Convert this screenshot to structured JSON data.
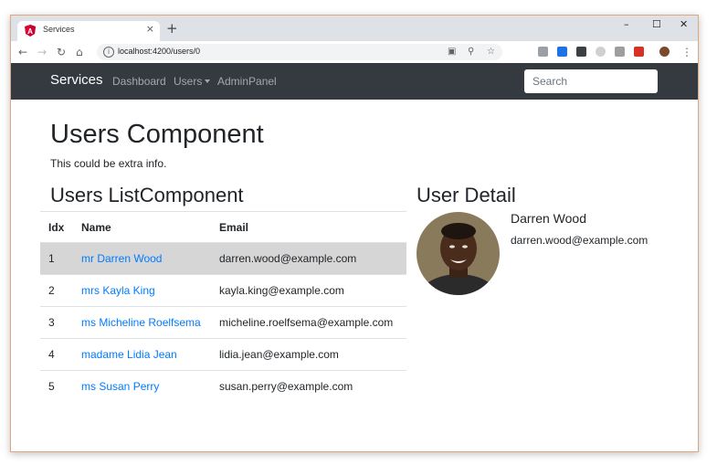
{
  "browser": {
    "tab_title": "Services",
    "tab_close": "×",
    "new_tab": "+",
    "win_minimize": "–",
    "win_maximize": "☐",
    "win_close": "✕",
    "url": "localhost:4200/users/0"
  },
  "navbar": {
    "brand": "Services",
    "links": [
      "Dashboard",
      "Users",
      "AdminPanel"
    ],
    "search_placeholder": "Search"
  },
  "page": {
    "title": "Users Component",
    "subtitle": "This could be extra info.",
    "list_heading": "Users ListComponent",
    "detail_heading": "User Detail"
  },
  "table": {
    "headers": [
      "Idx",
      "Name",
      "Email"
    ],
    "rows": [
      {
        "idx": "1",
        "name": "mr Darren Wood",
        "email": "darren.wood@example.com"
      },
      {
        "idx": "2",
        "name": "mrs Kayla King",
        "email": "kayla.king@example.com"
      },
      {
        "idx": "3",
        "name": "ms Micheline Roelfsema",
        "email": "micheline.roelfsema@example.com"
      },
      {
        "idx": "4",
        "name": "madame Lidia Jean",
        "email": "lidia.jean@example.com"
      },
      {
        "idx": "5",
        "name": "ms Susan Perry",
        "email": "susan.perry@example.com"
      }
    ]
  },
  "detail": {
    "name": "Darren Wood",
    "email": "darren.wood@example.com"
  },
  "colors": {
    "navbar_bg": "#343a40",
    "link": "#007bff",
    "active_row": "#d6d6d6"
  }
}
